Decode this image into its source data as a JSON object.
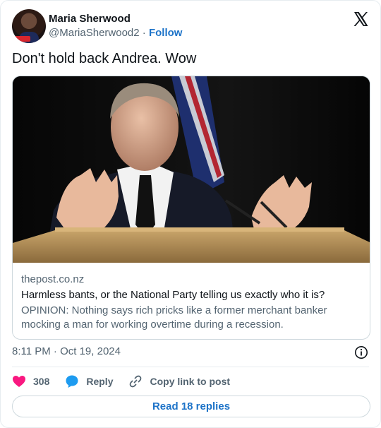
{
  "author": {
    "display_name": "Maria Sherwood",
    "handle": "@MariaSherwood2",
    "separator": "·",
    "follow_label": "Follow"
  },
  "tweet": {
    "text": "Don't hold back Andrea. Wow",
    "timestamp": "8:11 PM · Oct 19, 2024"
  },
  "link_card": {
    "domain": "thepost.co.nz",
    "title": "Harmless bants, or the National Party telling us exactly who it is?",
    "description": "OPINION: Nothing says rich pricks like a former merchant banker mocking a man for working overtime during a recession."
  },
  "actions": {
    "like_count": "308",
    "reply_label": "Reply",
    "copy_label": "Copy link to post"
  },
  "read_replies_label": "Read 18 replies",
  "colors": {
    "accent": "#1d73c8",
    "like": "#f91880",
    "muted": "#536471"
  },
  "icons": [
    "x-logo-icon",
    "info-icon",
    "heart-icon",
    "reply-bubble-icon",
    "link-icon"
  ]
}
